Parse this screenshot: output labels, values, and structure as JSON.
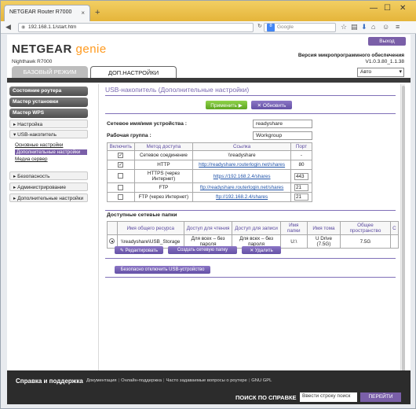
{
  "browser": {
    "tab_title": "NETGEAR Router R7000",
    "url": "192.168.1.1/start.htm",
    "search_placeholder": "Google",
    "new_tab": "+",
    "close_tab": "×",
    "minimize": "—",
    "maximize": "☐",
    "close_window": "✕"
  },
  "header": {
    "logo_text": "NETGEAR",
    "logo_accent": "genie",
    "model": "Nighthawk R7000",
    "logout_label": "Выход",
    "firmware_label": "Версия микропрограммного обеспечения",
    "firmware_version": "V1.0.3.80_1.1.38",
    "mode_basic": "БАЗОВЫЙ РЕЖИМ",
    "mode_advanced": "ДОП.НАСТРОЙКИ",
    "language": "Авто"
  },
  "sidebar": {
    "buttons": [
      "Состояние роутера",
      "Мастер установки",
      "Мастер WPS"
    ],
    "setup": "▸ Настройка",
    "usb": "▾ USB-накопитель",
    "usb_sub": [
      "Основные настройки",
      "Дополнительные настройки",
      "Медиа сервер"
    ],
    "rest": [
      "▸ Безопасность",
      "▸ Администрирование",
      "▸ Дополнительные настройки"
    ]
  },
  "main": {
    "title": "USB-накопитель (Дополнительные настройки)",
    "apply_label": "Применить ▶",
    "refresh_label": "✕ Обновить",
    "device_name_label": "Сетевое имя/имя устройства :",
    "device_name_value": "readyshare",
    "workgroup_label": "Рабочая группа :",
    "workgroup_value": "Workgroup",
    "access_headers": [
      "Включить",
      "Метод доступа",
      "Ссылка",
      "Порт"
    ],
    "access_rows": [
      {
        "enabled": true,
        "method": "Сетевое соединение",
        "link": "\\\\readyshare",
        "is_link": false,
        "port": "-"
      },
      {
        "enabled": true,
        "method": "HTTP",
        "link": "http://readyshare.routerlogin.net/shares",
        "is_link": true,
        "port": "80"
      },
      {
        "enabled": false,
        "method": "HTTPS (через Интернет)",
        "link": "https://192.168.2.4/shares",
        "is_link": true,
        "port": "443"
      },
      {
        "enabled": false,
        "method": "FTP",
        "link": "ftp://readyshare.routerlogin.net/shares",
        "is_link": true,
        "port": "21"
      },
      {
        "enabled": false,
        "method": "FTP (через Интернет)",
        "link": "ftp://192.168.2.4/shares",
        "is_link": true,
        "port": "21"
      }
    ],
    "shares_label": "Доступные сетевые папки",
    "share_headers": [
      "",
      "Имя общего ресурса",
      "Доступ для чтения",
      "Доступ для записи",
      "Имя папки",
      "Имя тома",
      "Общее пространство",
      "С"
    ],
    "share_rows": [
      {
        "name": "\\\\readyshare\\USB_Storage",
        "read": "Для всех – без пароля",
        "write": "Для всех – без пароля",
        "folder": "U:\\",
        "volume": "U Drive (7.5G)",
        "space": "7.5G",
        "extra": ""
      }
    ],
    "edit_label": "✎ Редактировать",
    "create_label": "Создать сетевую папку",
    "delete_label": "✕ Удалить",
    "safe_remove_label": "Безопасно отключить USB-устройство"
  },
  "footer": {
    "title": "Справка и поддержка",
    "links": [
      "Документация",
      "Онлайн-поддержка",
      "Часто задаваемые вопросы о роутере",
      "GNU GPL"
    ],
    "search_label": "ПОИСК ПО СПРАВКЕ",
    "search_value": "Ввести строку поиск",
    "go_label": "ПЕРЕЙТИ"
  }
}
